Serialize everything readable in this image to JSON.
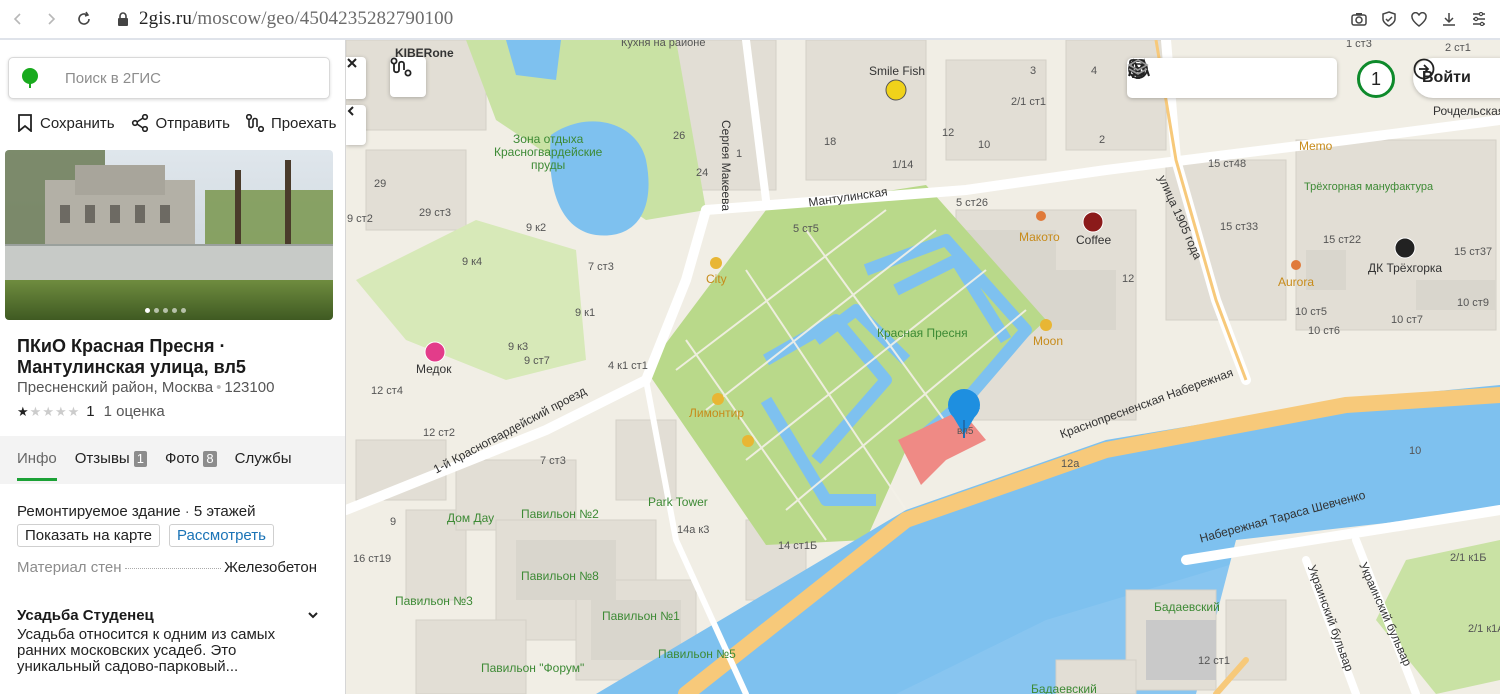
{
  "browser": {
    "url_host": "2gis.ru",
    "url_path": "/moscow/geo/4504235282790100"
  },
  "panel": {
    "search_placeholder": "Поиск в 2ГИС",
    "actions": [
      {
        "label": "Сохранить",
        "icon": "bookmark-icon"
      },
      {
        "label": "Отправить",
        "icon": "share-icon"
      },
      {
        "label": "Проехать",
        "icon": "route-icon"
      }
    ],
    "photo_count": 5,
    "title": "ПКиО Красная Пресня · Мантулинская улица, вл5",
    "district": "Пресненский район, Москва",
    "postcode": "123100",
    "rating_value": "1",
    "rating_count": "1 оценка",
    "rating_stars": 1,
    "tabs": [
      {
        "label": "Инфо",
        "badge": ""
      },
      {
        "label": "Отзывы",
        "badge": "1"
      },
      {
        "label": "Фото",
        "badge": "8"
      },
      {
        "label": "Службы",
        "badge": ""
      }
    ],
    "building_status": "Ремонтируемое здание",
    "floors": "5 этажей",
    "btn_show_map": "Показать на карте",
    "btn_view": "Рассмотреть",
    "material_label": "Материал стен",
    "material_value": "Железобетон",
    "section_title": "Усадьба Студенец",
    "section_desc": "Усадьба относится к одним из самых ранних московских усадеб. Это уникальный садово-парковый..."
  },
  "map": {
    "zoom": "1",
    "login_label": "Войти",
    "colors": {
      "park": "#b9d98a",
      "water": "#7ec1ef",
      "road": "#f7c97a",
      "building": "#e0ddd6",
      "accent": "#0e8a2b",
      "pin": "#1e8fe0"
    },
    "labels": {
      "kiberone": "KIBERone",
      "kukhnya": "Кухня на районе",
      "smile_fish": "Smile Fish",
      "zona_otdykha": "Зона отдыха\nКрасногвардейские\nпруды",
      "sergeya_makeeva": "Сергея Макеева",
      "mantulinskaya": "Мантулинская",
      "rochdelskaya": "Рочдельская",
      "memo": "Memo",
      "trekhgornaya": "Трёхгорная мануфактура",
      "ulitsa_1905": "улица 1905 года",
      "makoto": "Макото",
      "coffee": "Coffee",
      "dk_trekhgorka": "ДК Трёхгорка",
      "aurora": "Aurora",
      "city": "City",
      "krasnaya_presnya": "Красная Пресня",
      "moon": "Moon",
      "medok": "Медок",
      "limontir": "Лимонтир",
      "krasnogvard_proezd": "1-й Красногвардейский проезд",
      "krasnopresn_nab": "Краснопресненская Набережная",
      "nab_shevchenko": "Набережная Тараса Шевченко",
      "park_tower": "Park Tower",
      "dom_dau": "Дом Дау",
      "pav2": "Павильон №2",
      "pav8": "Павильон №8",
      "pav3": "Павильон №3",
      "pav1": "Павильон №1",
      "pav5": "Павильон №5",
      "pav_forum": "Павильон \"Форум\"",
      "badaevsky": "Бадаевский",
      "badaevsky2": "Бадаевский",
      "ukr_bulvar1": "Украинский бульвар",
      "ukr_bulvar2": "Украинский бульвар",
      "vl5": "вл5"
    },
    "house_numbers": [
      {
        "t": "26"
      },
      {
        "t": "18"
      },
      {
        "t": "1"
      },
      {
        "t": "24"
      },
      {
        "t": "1/14"
      },
      {
        "t": "29"
      },
      {
        "t": "29 ст3"
      },
      {
        "t": "9 ст2"
      },
      {
        "t": "9 к2"
      },
      {
        "t": "9 к4"
      },
      {
        "t": "7 ст3"
      },
      {
        "t": "9 к1"
      },
      {
        "t": "9 к3"
      },
      {
        "t": "9 ст7"
      },
      {
        "t": "4 к1 ст1"
      },
      {
        "t": "12 ст4"
      },
      {
        "t": "12 ст2"
      },
      {
        "t": "7 ст3"
      },
      {
        "t": "15 ст48"
      },
      {
        "t": "15 ст33"
      },
      {
        "t": "15 ст22"
      },
      {
        "t": "15 ст37"
      },
      {
        "t": "10 ст5"
      },
      {
        "t": "10 ст6"
      },
      {
        "t": "10 ст7"
      },
      {
        "t": "10 ст9"
      },
      {
        "t": "5 ст26"
      },
      {
        "t": "5 ст5"
      },
      {
        "t": "12"
      },
      {
        "t": "12a"
      },
      {
        "t": "10"
      },
      {
        "t": "14а к3"
      },
      {
        "t": "14 ст1Б"
      },
      {
        "t": "16 ст19"
      },
      {
        "t": "9"
      },
      {
        "t": "2/1 к1Б"
      },
      {
        "t": "2/1 к1А"
      },
      {
        "t": "12 ст1"
      },
      {
        "t": "2/1 ст1"
      },
      {
        "t": "2"
      },
      {
        "t": "3"
      },
      {
        "t": "4"
      },
      {
        "t": "12"
      },
      {
        "t": "10"
      },
      {
        "t": "1 ст3"
      },
      {
        "t": "2 ст1"
      }
    ]
  }
}
